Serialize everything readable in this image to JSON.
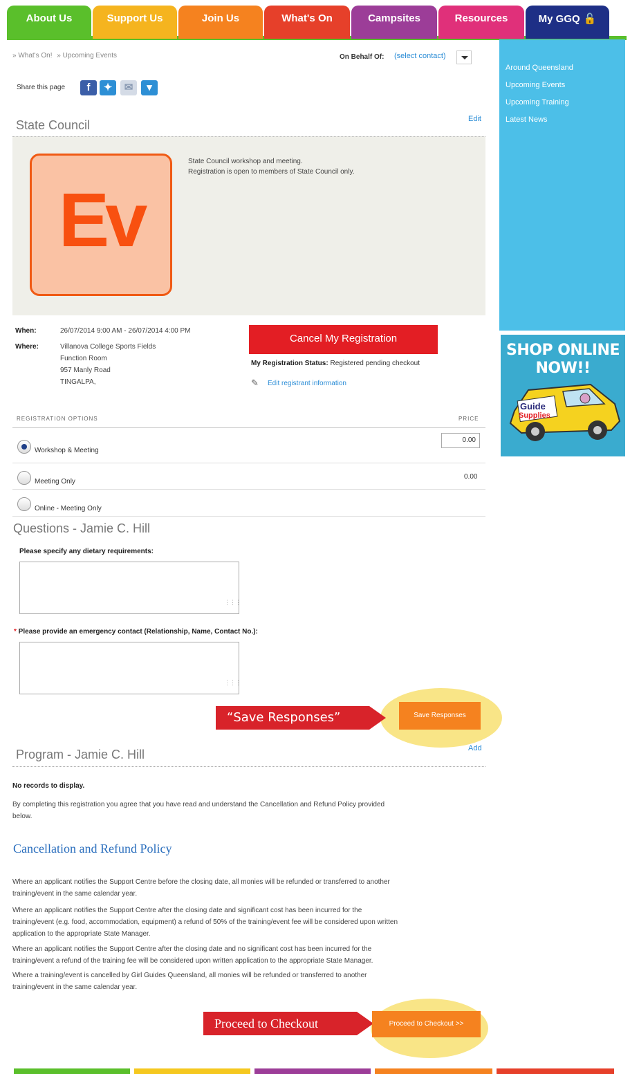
{
  "nav": {
    "tabs": [
      {
        "label": "About Us",
        "color": "#5abf2b"
      },
      {
        "label": "Support Us",
        "color": "#f5b41f"
      },
      {
        "label": "Join Us",
        "color": "#f5821f"
      },
      {
        "label": "What's On",
        "color": "#e6402a"
      },
      {
        "label": "Campsites",
        "color": "#9c3d98"
      },
      {
        "label": "Resources",
        "color": "#e0307a"
      },
      {
        "label": "My GGQ",
        "color": "#1e2f86"
      }
    ]
  },
  "breadcrumb": {
    "items": [
      "» What's On!",
      "» Upcoming Events"
    ]
  },
  "behalf": {
    "label": "On Behalf Of:",
    "link": "(select contact)"
  },
  "share": {
    "label": "Share this page"
  },
  "sidebar": {
    "links": [
      "Around Queensland",
      "Upcoming Events",
      "Upcoming Training",
      "Latest News"
    ],
    "shop_title": "SHOP ONLINE NOW!!",
    "van_line1": "Guide",
    "van_line2": "Supplies"
  },
  "event": {
    "title": "State Council",
    "edit": "Edit",
    "logo_text": "Ev",
    "desc_line1": "State Council workshop and meeting.",
    "desc_line2": "Registration is open to members of State Council only.",
    "when_label": "When:",
    "when_value": "26/07/2014 9:00 AM - 26/07/2014 4:00 PM",
    "where_label": "Where:",
    "where_lines": [
      "Villanova College Sports Fields",
      "Function Room",
      "957 Manly Road",
      "TINGALPA,"
    ],
    "cancel_button": "Cancel My Registration",
    "status_label": "My Registration Status:",
    "status_value": "Registered pending checkout",
    "edit_registrant": "Edit registrant information"
  },
  "options": {
    "header": "REGISTRATION OPTIONS",
    "price_header": "PRICE",
    "items": [
      {
        "label": "Workshop & Meeting",
        "selected": true,
        "price": "0.00"
      },
      {
        "label": "Meeting Only",
        "selected": false,
        "price": "0.00"
      },
      {
        "label": "Online - Meeting Only",
        "selected": false,
        "price": ""
      }
    ]
  },
  "questions": {
    "title": "Questions - Jamie C. Hill",
    "q1": "Please specify any dietary requirements:",
    "q2_req": "*",
    "q2": " Please provide an emergency contact (Relationship, Name, Contact No.):",
    "callout": "“Save Responses”",
    "save_button": "Save Responses"
  },
  "program": {
    "title": "Program - Jamie C. Hill",
    "add": "Add",
    "no_records": "No records to display.",
    "agree_line1": "By completing this registration you agree that you have read and understand the Cancellation and Refund Policy provided",
    "agree_line2": "below."
  },
  "policy": {
    "title": "Cancellation and Refund Policy",
    "p1": [
      "Where an applicant notifies the Support Centre before the closing date, all monies will be refunded or transferred to another",
      "training/event in the same calendar year."
    ],
    "p2": [
      "Where an applicant notifies the Support Centre after the closing date and significant cost has been incurred for the",
      "training/event (e.g. food, accommodation, equipment) a refund of 50% of the training/event fee will be considered upon written",
      "application to the appropriate State Manager."
    ],
    "p3": [
      "Where an applicant notifies the Support Centre after the closing date and no significant cost has been incurred for the",
      "training/event a refund of the training fee will be considered upon written application to the appropriate State Manager."
    ],
    "p4": [
      "Where a training/event is cancelled by Girl Guides Queensland, all monies will be refunded or transferred to another",
      "training/event in the same calendar year."
    ]
  },
  "checkout": {
    "callout": "Proceed to Checkout",
    "button": "Proceed to Checkout >>"
  },
  "footer": {
    "colors": [
      "#5abf2b",
      "#f5c81f",
      "#9c3d98",
      "#f5821f",
      "#e6402a"
    ]
  }
}
